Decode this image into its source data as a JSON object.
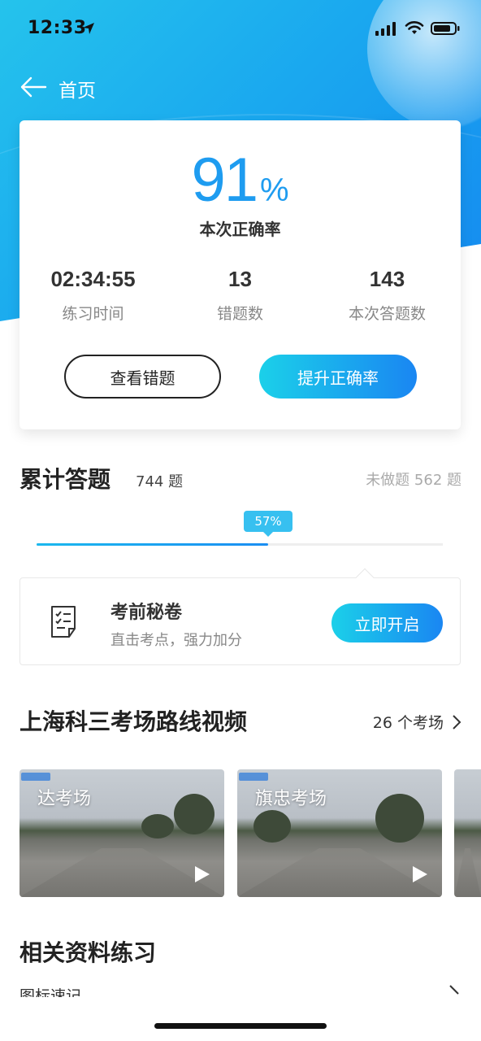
{
  "status_bar": {
    "time": "12:33"
  },
  "nav": {
    "back_label": "首页"
  },
  "score_card": {
    "score_value": "91",
    "score_unit": "%",
    "score_label": "本次正确率",
    "stats": [
      {
        "value": "02:34:55",
        "label": "练习时间"
      },
      {
        "value": "13",
        "label": "错题数"
      },
      {
        "value": "143",
        "label": "本次答题数"
      }
    ],
    "view_wrong_label": "查看错题",
    "improve_label": "提升正确率"
  },
  "cumulative": {
    "title": "累计答题",
    "count": "744 题",
    "remaining": "未做题 562 题",
    "progress_percent": 57,
    "progress_label": "57%"
  },
  "promo": {
    "title": "考前秘卷",
    "subtitle": "直击考点，强力加分",
    "button_label": "立即开启"
  },
  "videos": {
    "title": "上海科三考场路线视频",
    "more_label": "26 个考场",
    "items": [
      {
        "label": "达考场"
      },
      {
        "label": "旗忠考场"
      },
      {
        "label": ""
      }
    ]
  },
  "related": {
    "title": "相关资料练习",
    "first_item": "图标速记"
  },
  "colors": {
    "accent": "#1e9cf0",
    "gradient_start": "#1bd0e9",
    "gradient_end": "#1a86f2"
  }
}
